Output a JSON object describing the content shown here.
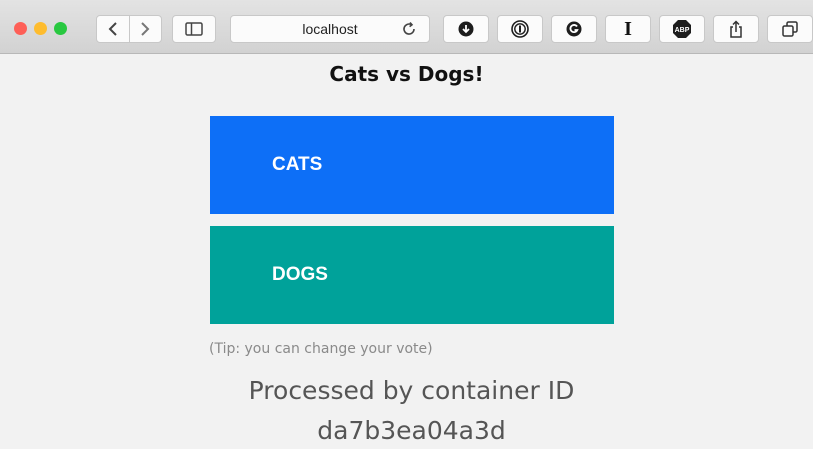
{
  "browser": {
    "url": "localhost",
    "icons": {
      "back": "chevron-left-icon",
      "forward": "chevron-right-icon",
      "sidebar": "sidebar-icon",
      "reload": "reload-icon",
      "download": "download-icon",
      "onepassword": "password-manager-icon",
      "grammarly": "grammarly-icon",
      "instapaper": "instapaper-icon",
      "adblock": "adblock-icon",
      "share": "share-icon",
      "tabs": "tabs-icon"
    },
    "adblock_text": "ABP",
    "instapaper_text": "I",
    "traffic_colors": {
      "close": "#fe5f57",
      "minimize": "#febc2e",
      "maximize": "#28c840"
    }
  },
  "page": {
    "title": "Cats vs Dogs!",
    "options": [
      {
        "label": "CATS",
        "color": "#0d6ff7"
      },
      {
        "label": "DOGS",
        "color": "#00a29a"
      }
    ],
    "tip": "(Tip: you can change your vote)",
    "processed_label": "Processed by container ID",
    "container_id": "da7b3ea04a3d"
  }
}
